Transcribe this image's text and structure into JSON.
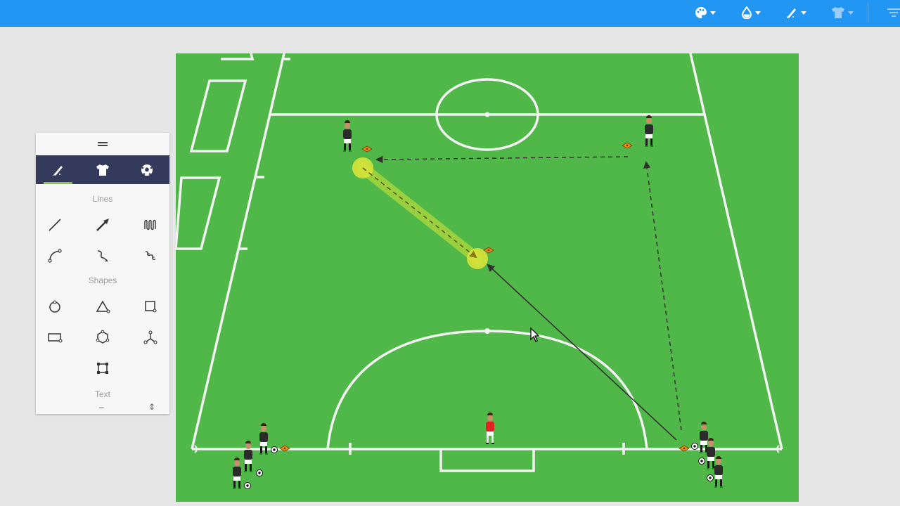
{
  "topbar": {
    "color": "#2196f3",
    "buttons": [
      {
        "icon": "palette-icon"
      },
      {
        "icon": "water-drop-icon"
      },
      {
        "icon": "pen-style-icon"
      },
      {
        "icon": "jersey-icon"
      },
      {
        "icon": "filter-icon"
      }
    ]
  },
  "toolbox": {
    "tabs": [
      {
        "icon": "pencil-icon",
        "active": true
      },
      {
        "icon": "shirt-icon",
        "active": false
      },
      {
        "icon": "soccer-ball-icon",
        "active": false
      }
    ],
    "lines_label": "Lines",
    "shapes_label": "Shapes",
    "text_label": "Text",
    "line_tools": [
      "straight-line-icon",
      "arrow-line-icon",
      "zigzag-line-icon",
      "curved-line-icon",
      "freehand-line-icon",
      "wavy-line-icon"
    ],
    "shape_tools": [
      "circle-shape-icon",
      "triangle-shape-icon",
      "square-shape-icon",
      "rectangle-shape-icon",
      "polygon-shape-icon",
      "star-shape-icon",
      "frame-shape-icon"
    ],
    "tab_accent": "#8bc34a",
    "tab_bg": "#333a5c"
  },
  "pitch": {
    "grass_color": "#50b848",
    "highlight_color": "#d6e33a"
  }
}
